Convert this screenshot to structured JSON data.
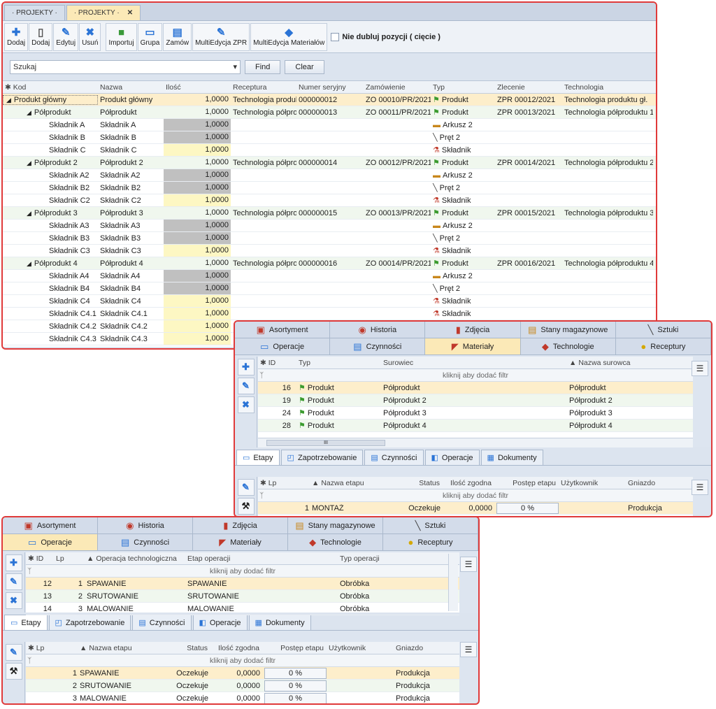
{
  "w1": {
    "tabs": [
      "· PROJEKTY ·",
      "· PROJEKTY ·"
    ],
    "tab_close": "✕",
    "toolbar": [
      "Dodaj",
      "Dodaj",
      "Edytuj",
      "Usuń",
      "Importuj",
      "Grupa",
      "Zamów",
      "MultiEdycja ZPR",
      "MultiEdycja Materiałów"
    ],
    "checkbox_label": "Nie dubluj pozycji ( cięcie )",
    "search_placeholder": "Szukaj",
    "find": "Find",
    "clear": "Clear",
    "columns": [
      "Kod",
      "Nazwa",
      "Ilość",
      "Receptura",
      "Numer seryjny",
      "Zamówienie",
      "Typ",
      "Zlecenie",
      "Technologia"
    ],
    "rows": [
      {
        "kod": "Produkt główny",
        "nazwa": "Produkt główny",
        "ilosc": "1,0000",
        "receptura": "Technologia produkt",
        "numer": "000000012",
        "zam": "ZO 00010/PR/2021",
        "typ": "Produkt",
        "zlec": "ZPR 00012/2021",
        "tech": "Technologia produktu gł."
      },
      {
        "kod": "Półprodukt",
        "nazwa": "Półprodukt",
        "ilosc": "1,0000",
        "receptura": "Technologia półprod",
        "numer": "000000013",
        "zam": "ZO 00011/PR/2021",
        "typ": "Produkt",
        "zlec": "ZPR 00013/2021",
        "tech": "Technologia półproduktu 1"
      },
      {
        "kod": "Składnik A",
        "nazwa": "Składnik A",
        "ilosc": "1,0000",
        "receptura": "",
        "numer": "",
        "zam": "",
        "typ": "Arkusz 2",
        "zlec": "",
        "tech": ""
      },
      {
        "kod": "Składnik B",
        "nazwa": "Składnik B",
        "ilosc": "1,0000",
        "receptura": "",
        "numer": "",
        "zam": "",
        "typ": "Pręt 2",
        "zlec": "",
        "tech": ""
      },
      {
        "kod": "Składnik C",
        "nazwa": "Składnik C",
        "ilosc": "1,0000",
        "receptura": "",
        "numer": "",
        "zam": "",
        "typ": "Składnik",
        "zlec": "",
        "tech": ""
      },
      {
        "kod": "Półprodukt 2",
        "nazwa": "Półprodukt 2",
        "ilosc": "1,0000",
        "receptura": "Technologia półprod",
        "numer": "000000014",
        "zam": "ZO 00012/PR/2021",
        "typ": "Produkt",
        "zlec": "ZPR 00014/2021",
        "tech": "Technologia półproduktu 2"
      },
      {
        "kod": "Składnik A2",
        "nazwa": "Składnik A2",
        "ilosc": "1,0000",
        "receptura": "",
        "numer": "",
        "zam": "",
        "typ": "Arkusz 2",
        "zlec": "",
        "tech": ""
      },
      {
        "kod": "Składnik B2",
        "nazwa": "Składnik B2",
        "ilosc": "1,0000",
        "receptura": "",
        "numer": "",
        "zam": "",
        "typ": "Pręt 2",
        "zlec": "",
        "tech": ""
      },
      {
        "kod": "Składnik C2",
        "nazwa": "Składnik C2",
        "ilosc": "1,0000",
        "receptura": "",
        "numer": "",
        "zam": "",
        "typ": "Składnik",
        "zlec": "",
        "tech": ""
      },
      {
        "kod": "Półprodukt 3",
        "nazwa": "Półprodukt 3",
        "ilosc": "1,0000",
        "receptura": "Technologia półprod",
        "numer": "000000015",
        "zam": "ZO 00013/PR/2021",
        "typ": "Produkt",
        "zlec": "ZPR 00015/2021",
        "tech": "Technologia półproduktu 3"
      },
      {
        "kod": "Składnik A3",
        "nazwa": "Składnik A3",
        "ilosc": "1,0000",
        "receptura": "",
        "numer": "",
        "zam": "",
        "typ": "Arkusz 2",
        "zlec": "",
        "tech": ""
      },
      {
        "kod": "Składnik B3",
        "nazwa": "Składnik B3",
        "ilosc": "1,0000",
        "receptura": "",
        "numer": "",
        "zam": "",
        "typ": "Pręt 2",
        "zlec": "",
        "tech": ""
      },
      {
        "kod": "Składnik C3",
        "nazwa": "Składnik C3",
        "ilosc": "1,0000",
        "receptura": "",
        "numer": "",
        "zam": "",
        "typ": "Składnik",
        "zlec": "",
        "tech": ""
      },
      {
        "kod": "Półprodukt 4",
        "nazwa": "Półprodukt 4",
        "ilosc": "1,0000",
        "receptura": "Technologia półprod",
        "numer": "000000016",
        "zam": "ZO 00014/PR/2021",
        "typ": "Produkt",
        "zlec": "ZPR 00016/2021",
        "tech": "Technologia półproduktu 4"
      },
      {
        "kod": "Składnik A4",
        "nazwa": "Składnik A4",
        "ilosc": "1,0000",
        "receptura": "",
        "numer": "",
        "zam": "",
        "typ": "Arkusz 2",
        "zlec": "",
        "tech": ""
      },
      {
        "kod": "Składnik B4",
        "nazwa": "Składnik B4",
        "ilosc": "1,0000",
        "receptura": "",
        "numer": "",
        "zam": "",
        "typ": "Pręt 2",
        "zlec": "",
        "tech": ""
      },
      {
        "kod": "Składnik C4",
        "nazwa": "Składnik C4",
        "ilosc": "1,0000",
        "receptura": "",
        "numer": "",
        "zam": "",
        "typ": "Składnik",
        "zlec": "",
        "tech": ""
      },
      {
        "kod": "Składnik C4.1",
        "nazwa": "Składnik C4.1",
        "ilosc": "1,0000",
        "receptura": "",
        "numer": "",
        "zam": "",
        "typ": "Składnik",
        "zlec": "",
        "tech": ""
      },
      {
        "kod": "Składnik C4.2",
        "nazwa": "Składnik C4.2",
        "ilosc": "1,0000",
        "receptura": "",
        "numer": "",
        "zam": "",
        "typ": "",
        "zlec": "",
        "tech": ""
      },
      {
        "kod": "Składnik C4.3",
        "nazwa": "Składnik C4.3",
        "ilosc": "1,0000",
        "receptura": "",
        "numer": "",
        "zam": "",
        "typ": "",
        "zlec": "",
        "tech": ""
      }
    ]
  },
  "w2": {
    "tabs_top": [
      "Asortyment",
      "Historia",
      "Zdjęcia",
      "Stany magazynowe",
      "Sztuki"
    ],
    "tabs_bottom": [
      "Operacje",
      "Czynności",
      "Materiały",
      "Technologie",
      "Receptury"
    ],
    "columns": [
      "ID",
      "Typ",
      "Surowiec",
      "Nazwa surowca"
    ],
    "filter": "kliknij aby dodać filtr",
    "rows": [
      {
        "id": "16",
        "typ": "Produkt",
        "sur": "Półprodukt",
        "naz": "Półprodukt"
      },
      {
        "id": "19",
        "typ": "Produkt",
        "sur": "Półprodukt 2",
        "naz": "Półprodukt 2"
      },
      {
        "id": "24",
        "typ": "Produkt",
        "sur": "Półprodukt 3",
        "naz": "Półprodukt 3"
      },
      {
        "id": "28",
        "typ": "Produkt",
        "sur": "Półprodukt 4",
        "naz": "Półprodukt 4"
      }
    ],
    "scroll_mark": "III",
    "mtabs": [
      "Etapy",
      "Zapotrzebowanie",
      "Czynności",
      "Operacje",
      "Dokumenty"
    ],
    "etap_columns": [
      "Lp",
      "Nazwa etapu",
      "Status",
      "Ilość zgodna",
      "Postęp etapu",
      "Użytkownik",
      "Gniazdo"
    ],
    "etap_rows": [
      {
        "lp": "1",
        "nazwa": "MONTAŻ",
        "status": "Oczekuje",
        "ilosc": "0,0000",
        "postep": "0 %",
        "gniazdo": "Produkcja"
      }
    ]
  },
  "w3": {
    "tabs_top": [
      "Asortyment",
      "Historia",
      "Zdjęcia",
      "Stany magazynowe",
      "Sztuki"
    ],
    "tabs_bottom": [
      "Operacje",
      "Czynności",
      "Materiały",
      "Technologie",
      "Receptury"
    ],
    "columns": [
      "ID",
      "Lp",
      "Operacja technologiczna",
      "Etap operacji",
      "Typ operacji"
    ],
    "filter": "kliknij aby dodać filtr",
    "rows": [
      {
        "id": "12",
        "lp": "1",
        "op": "SPAWANIE",
        "etap": "SPAWANIE",
        "typ": "Obróbka"
      },
      {
        "id": "13",
        "lp": "2",
        "op": "ŚRUTOWANIE",
        "etap": "ŚRUTOWANIE",
        "typ": "Obróbka"
      },
      {
        "id": "14",
        "lp": "3",
        "op": "MALOWANIE",
        "etap": "MALOWANIE",
        "typ": "Obróbka"
      }
    ],
    "mtabs": [
      "Etapy",
      "Zapotrzebowanie",
      "Czynności",
      "Operacje",
      "Dokumenty"
    ],
    "etap_columns": [
      "Lp",
      "Nazwa etapu",
      "Status",
      "Ilość zgodna",
      "Postęp etapu",
      "Użytkownik",
      "Gniazdo"
    ],
    "etap_rows": [
      {
        "lp": "1",
        "nazwa": "SPAWANIE",
        "status": "Oczekuje",
        "ilosc": "0,0000",
        "postep": "0 %",
        "gniazdo": "Produkcja"
      },
      {
        "lp": "2",
        "nazwa": "ŚRUTOWANIE",
        "status": "Oczekuje",
        "ilosc": "0,0000",
        "postep": "0 %",
        "gniazdo": "Produkcja"
      },
      {
        "lp": "3",
        "nazwa": "MALOWANIE",
        "status": "Oczekuje",
        "ilosc": "0,0000",
        "postep": "0 %",
        "gniazdo": "Produkcja"
      }
    ]
  }
}
